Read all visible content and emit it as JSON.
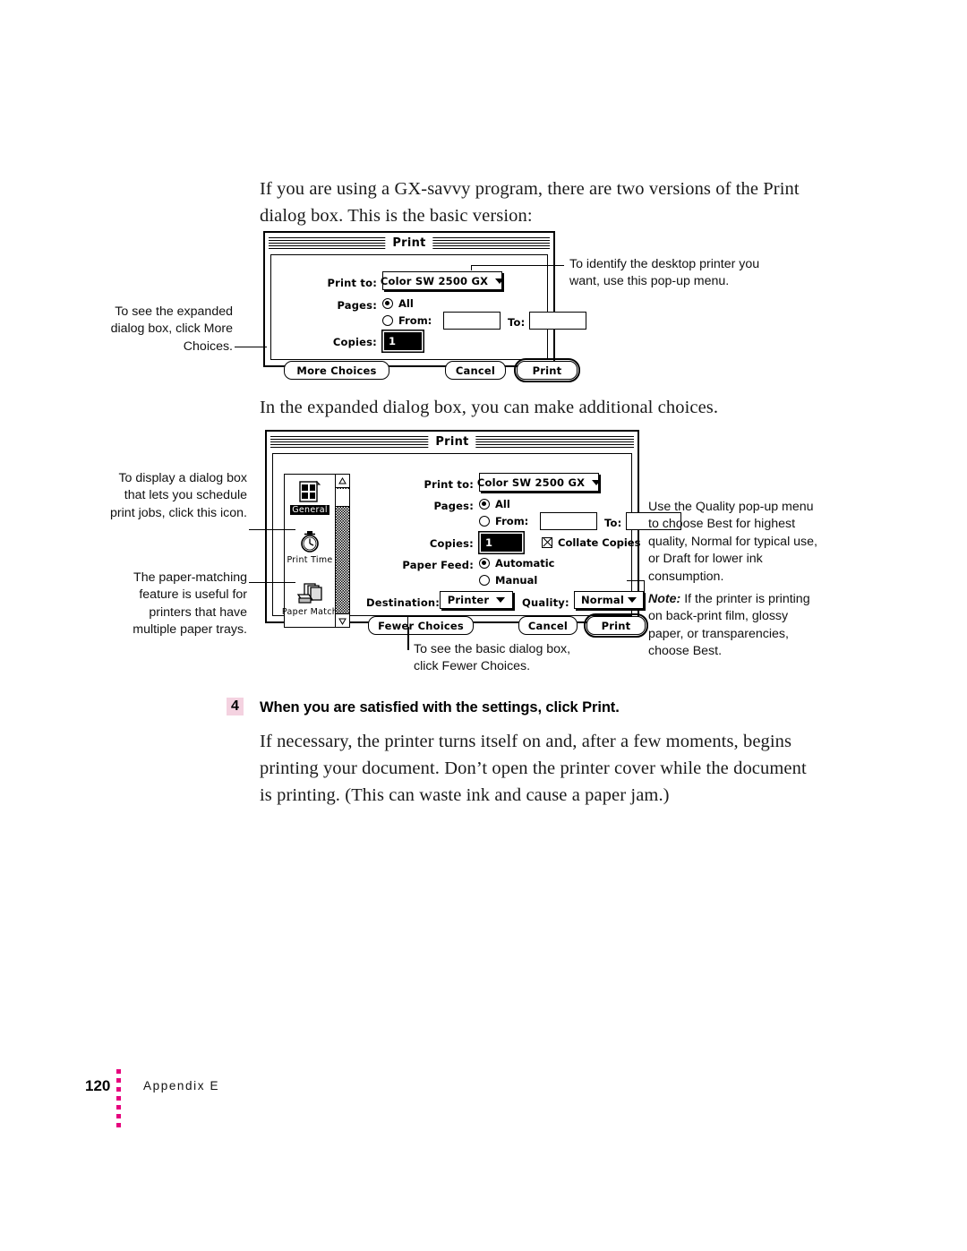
{
  "page": {
    "intro_paragraph": "If you are using a GX-savvy program, there are two versions of the Print dialog box. This is the basic version:",
    "middle_paragraph": "In the expanded dialog box, you can make additional choices.",
    "closing_paragraph": "If necessary, the printer turns itself on and, after a few moments, begins printing your document. Don’t open the printer cover while the document is printing. (This can waste ink and cause a paper jam.)"
  },
  "step": {
    "number": "4",
    "text": "When you are satisfied with the settings, click Print.",
    "number_bg": "#f4d2e0"
  },
  "basic_dialog": {
    "title": "Print",
    "print_to_label": "Print to:",
    "print_to_value": "Color SW 2500 GX",
    "pages_label": "Pages:",
    "pages_all": "All",
    "pages_from": "From:",
    "pages_to": "To:",
    "from_value": "",
    "to_value": "",
    "copies_label": "Copies:",
    "copies_value": "1",
    "more_choices": "More Choices",
    "cancel": "Cancel",
    "print": "Print"
  },
  "expanded_dialog": {
    "title": "Print",
    "icons": [
      {
        "caption": "General",
        "icon": "document-page-icon",
        "selected": true
      },
      {
        "caption": "Print Time",
        "icon": "stopwatch-icon",
        "selected": false
      },
      {
        "caption": "Paper Match",
        "icon": "paper-stack-icon",
        "selected": false
      }
    ],
    "print_to_label": "Print to:",
    "print_to_value": "Color SW 2500 GX",
    "pages_label": "Pages:",
    "pages_all": "All",
    "pages_from": "From:",
    "pages_to": "To:",
    "from_value": "",
    "to_value": "",
    "copies_label": "Copies:",
    "copies_value": "1",
    "collate_label": "Collate Copies",
    "paper_feed_label": "Paper Feed:",
    "paper_feed_auto": "Automatic",
    "paper_feed_manual": "Manual",
    "destination_label": "Destination:",
    "destination_value": "Printer",
    "quality_label": "Quality:",
    "quality_value": "Normal",
    "fewer_choices": "Fewer Choices",
    "cancel": "Cancel",
    "print": "Print"
  },
  "callouts": {
    "basic_left": "To see the expanded dialog box, click More Choices.",
    "basic_right": "To identify the desktop printer you want, use this pop-up menu.",
    "expanded_left_top": "To display a dialog box that lets you schedule print jobs, click this icon.",
    "expanded_left_bottom": "The paper-matching feature is useful for printers that have multiple paper trays.",
    "expanded_right_quality": "Use the Quality pop-up menu to choose Best for highest quality, Normal for typical use, or Draft for lower ink consumption.",
    "expanded_right_note_label": "Note:",
    "expanded_right_note_text": "If the printer is printing on back-print film, glossy paper, or transparencies, choose Best.",
    "expanded_bottom": "To see the basic dialog box, click Fewer Choices."
  },
  "footer": {
    "page_number": "120",
    "section": "Appendix E",
    "dot_color": "#e6007e",
    "dot_count": 7
  }
}
